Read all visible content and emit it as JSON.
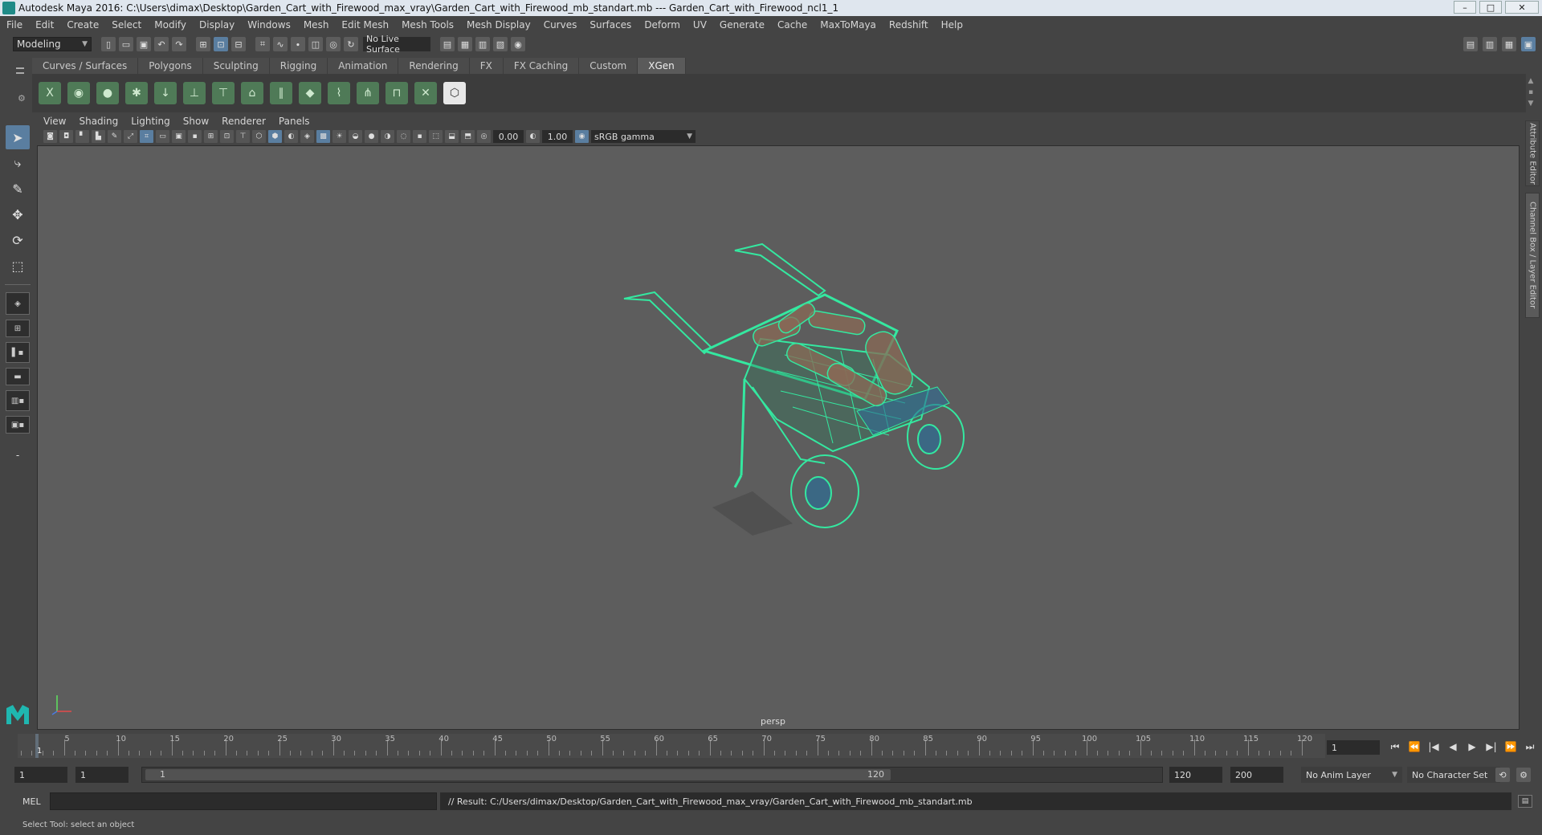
{
  "window": {
    "title": "Autodesk Maya 2016: C:\\Users\\dimax\\Desktop\\Garden_Cart_with_Firewood_max_vray\\Garden_Cart_with_Firewood_mb_standart.mb   ---   Garden_Cart_with_Firewood_ncl1_1",
    "controls": [
      "–",
      "□",
      "✕"
    ]
  },
  "menubar": [
    "File",
    "Edit",
    "Create",
    "Select",
    "Modify",
    "Display",
    "Windows",
    "Mesh",
    "Edit Mesh",
    "Mesh Tools",
    "Mesh Display",
    "Curves",
    "Surfaces",
    "Deform",
    "UV",
    "Generate",
    "Cache",
    "MaxToMaya",
    "Redshift",
    "Help"
  ],
  "statusline": {
    "mode": "Modeling",
    "live_surface": "No Live Surface"
  },
  "shelf": {
    "tabs": [
      "Curves / Surfaces",
      "Polygons",
      "Sculpting",
      "Rigging",
      "Animation",
      "Rendering",
      "FX",
      "FX Caching",
      "Custom",
      "XGen"
    ],
    "active_tab": "XGen"
  },
  "panel": {
    "menus": [
      "View",
      "Shading",
      "Lighting",
      "Show",
      "Renderer",
      "Panels"
    ],
    "exposure": "0.00",
    "gamma": "1.00",
    "color_space": "sRGB gamma",
    "camera_label": "persp"
  },
  "right_dock": {
    "tabs": [
      "Attribute Editor",
      "Channel Box / Layer Editor"
    ]
  },
  "timeslider": {
    "ticks": [
      "5",
      "10",
      "15",
      "20",
      "25",
      "30",
      "35",
      "40",
      "45",
      "50",
      "55",
      "60",
      "65",
      "70",
      "75",
      "80",
      "85",
      "90",
      "95",
      "100",
      "105",
      "110",
      "115",
      "120"
    ],
    "current_frame_label": "1",
    "current_frame_field": "1",
    "playback": [
      "⏮",
      "⏪",
      "|◀",
      "◀",
      "▶",
      "▶|",
      "⏩",
      "⏭"
    ]
  },
  "range": {
    "start_field": "1",
    "start_field2": "1",
    "handle_start": "1",
    "handle_end": "120",
    "end_field": "120",
    "end_field2": "200",
    "anim_layer": "No Anim Layer",
    "character_set": "No Character Set"
  },
  "command_line": {
    "label": "MEL",
    "result": "// Result: C:/Users/dimax/Desktop/Garden_Cart_with_Firewood_max_vray/Garden_Cart_with_Firewood_mb_standart.mb"
  },
  "help_line": "Select Tool: select an object",
  "colors": {
    "wireframe": "#34e8a0",
    "viewport_bg": "#5d5d5d",
    "accent": "#5a7ea0",
    "firewood": "#8a6a55"
  }
}
